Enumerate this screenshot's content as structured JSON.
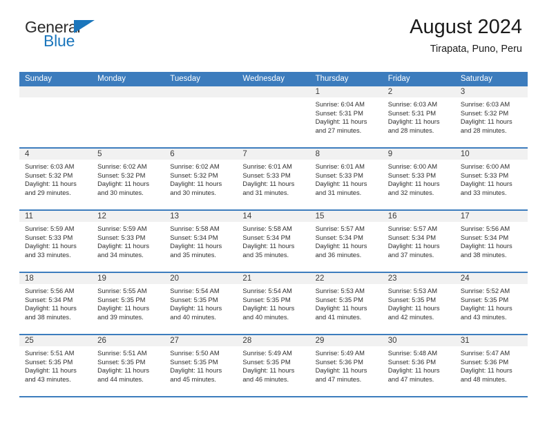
{
  "brand": {
    "name_part1": "General",
    "name_part2": "Blue",
    "triangle_icon": "blue-triangle-logo-mark",
    "color_dark": "#2b2b2b",
    "color_blue": "#1b76bc"
  },
  "header": {
    "title": "August 2024",
    "subtitle": "Tirapata, Puno, Peru"
  },
  "theme": {
    "header_row_bg": "#3c7cbd",
    "day_band_bg": "#f1f1f1",
    "cell_bg": "#ffffff",
    "text": "#2e2e2e"
  },
  "weekdays": [
    "Sunday",
    "Monday",
    "Tuesday",
    "Wednesday",
    "Thursday",
    "Friday",
    "Saturday"
  ],
  "weeks": [
    [
      {
        "day": "",
        "empty": true,
        "lines": []
      },
      {
        "day": "",
        "empty": true,
        "lines": []
      },
      {
        "day": "",
        "empty": true,
        "lines": []
      },
      {
        "day": "",
        "empty": true,
        "lines": []
      },
      {
        "day": "1",
        "empty": false,
        "lines": [
          "Sunrise: 6:04 AM",
          "Sunset: 5:31 PM",
          "Daylight: 11 hours",
          "and 27 minutes."
        ]
      },
      {
        "day": "2",
        "empty": false,
        "lines": [
          "Sunrise: 6:03 AM",
          "Sunset: 5:31 PM",
          "Daylight: 11 hours",
          "and 28 minutes."
        ]
      },
      {
        "day": "3",
        "empty": false,
        "lines": [
          "Sunrise: 6:03 AM",
          "Sunset: 5:32 PM",
          "Daylight: 11 hours",
          "and 28 minutes."
        ]
      }
    ],
    [
      {
        "day": "4",
        "empty": false,
        "lines": [
          "Sunrise: 6:03 AM",
          "Sunset: 5:32 PM",
          "Daylight: 11 hours",
          "and 29 minutes."
        ]
      },
      {
        "day": "5",
        "empty": false,
        "lines": [
          "Sunrise: 6:02 AM",
          "Sunset: 5:32 PM",
          "Daylight: 11 hours",
          "and 30 minutes."
        ]
      },
      {
        "day": "6",
        "empty": false,
        "lines": [
          "Sunrise: 6:02 AM",
          "Sunset: 5:32 PM",
          "Daylight: 11 hours",
          "and 30 minutes."
        ]
      },
      {
        "day": "7",
        "empty": false,
        "lines": [
          "Sunrise: 6:01 AM",
          "Sunset: 5:33 PM",
          "Daylight: 11 hours",
          "and 31 minutes."
        ]
      },
      {
        "day": "8",
        "empty": false,
        "lines": [
          "Sunrise: 6:01 AM",
          "Sunset: 5:33 PM",
          "Daylight: 11 hours",
          "and 31 minutes."
        ]
      },
      {
        "day": "9",
        "empty": false,
        "lines": [
          "Sunrise: 6:00 AM",
          "Sunset: 5:33 PM",
          "Daylight: 11 hours",
          "and 32 minutes."
        ]
      },
      {
        "day": "10",
        "empty": false,
        "lines": [
          "Sunrise: 6:00 AM",
          "Sunset: 5:33 PM",
          "Daylight: 11 hours",
          "and 33 minutes."
        ]
      }
    ],
    [
      {
        "day": "11",
        "empty": false,
        "lines": [
          "Sunrise: 5:59 AM",
          "Sunset: 5:33 PM",
          "Daylight: 11 hours",
          "and 33 minutes."
        ]
      },
      {
        "day": "12",
        "empty": false,
        "lines": [
          "Sunrise: 5:59 AM",
          "Sunset: 5:33 PM",
          "Daylight: 11 hours",
          "and 34 minutes."
        ]
      },
      {
        "day": "13",
        "empty": false,
        "lines": [
          "Sunrise: 5:58 AM",
          "Sunset: 5:34 PM",
          "Daylight: 11 hours",
          "and 35 minutes."
        ]
      },
      {
        "day": "14",
        "empty": false,
        "lines": [
          "Sunrise: 5:58 AM",
          "Sunset: 5:34 PM",
          "Daylight: 11 hours",
          "and 35 minutes."
        ]
      },
      {
        "day": "15",
        "empty": false,
        "lines": [
          "Sunrise: 5:57 AM",
          "Sunset: 5:34 PM",
          "Daylight: 11 hours",
          "and 36 minutes."
        ]
      },
      {
        "day": "16",
        "empty": false,
        "lines": [
          "Sunrise: 5:57 AM",
          "Sunset: 5:34 PM",
          "Daylight: 11 hours",
          "and 37 minutes."
        ]
      },
      {
        "day": "17",
        "empty": false,
        "lines": [
          "Sunrise: 5:56 AM",
          "Sunset: 5:34 PM",
          "Daylight: 11 hours",
          "and 38 minutes."
        ]
      }
    ],
    [
      {
        "day": "18",
        "empty": false,
        "lines": [
          "Sunrise: 5:56 AM",
          "Sunset: 5:34 PM",
          "Daylight: 11 hours",
          "and 38 minutes."
        ]
      },
      {
        "day": "19",
        "empty": false,
        "lines": [
          "Sunrise: 5:55 AM",
          "Sunset: 5:35 PM",
          "Daylight: 11 hours",
          "and 39 minutes."
        ]
      },
      {
        "day": "20",
        "empty": false,
        "lines": [
          "Sunrise: 5:54 AM",
          "Sunset: 5:35 PM",
          "Daylight: 11 hours",
          "and 40 minutes."
        ]
      },
      {
        "day": "21",
        "empty": false,
        "lines": [
          "Sunrise: 5:54 AM",
          "Sunset: 5:35 PM",
          "Daylight: 11 hours",
          "and 40 minutes."
        ]
      },
      {
        "day": "22",
        "empty": false,
        "lines": [
          "Sunrise: 5:53 AM",
          "Sunset: 5:35 PM",
          "Daylight: 11 hours",
          "and 41 minutes."
        ]
      },
      {
        "day": "23",
        "empty": false,
        "lines": [
          "Sunrise: 5:53 AM",
          "Sunset: 5:35 PM",
          "Daylight: 11 hours",
          "and 42 minutes."
        ]
      },
      {
        "day": "24",
        "empty": false,
        "lines": [
          "Sunrise: 5:52 AM",
          "Sunset: 5:35 PM",
          "Daylight: 11 hours",
          "and 43 minutes."
        ]
      }
    ],
    [
      {
        "day": "25",
        "empty": false,
        "lines": [
          "Sunrise: 5:51 AM",
          "Sunset: 5:35 PM",
          "Daylight: 11 hours",
          "and 43 minutes."
        ]
      },
      {
        "day": "26",
        "empty": false,
        "lines": [
          "Sunrise: 5:51 AM",
          "Sunset: 5:35 PM",
          "Daylight: 11 hours",
          "and 44 minutes."
        ]
      },
      {
        "day": "27",
        "empty": false,
        "lines": [
          "Sunrise: 5:50 AM",
          "Sunset: 5:35 PM",
          "Daylight: 11 hours",
          "and 45 minutes."
        ]
      },
      {
        "day": "28",
        "empty": false,
        "lines": [
          "Sunrise: 5:49 AM",
          "Sunset: 5:35 PM",
          "Daylight: 11 hours",
          "and 46 minutes."
        ]
      },
      {
        "day": "29",
        "empty": false,
        "lines": [
          "Sunrise: 5:49 AM",
          "Sunset: 5:36 PM",
          "Daylight: 11 hours",
          "and 47 minutes."
        ]
      },
      {
        "day": "30",
        "empty": false,
        "lines": [
          "Sunrise: 5:48 AM",
          "Sunset: 5:36 PM",
          "Daylight: 11 hours",
          "and 47 minutes."
        ]
      },
      {
        "day": "31",
        "empty": false,
        "lines": [
          "Sunrise: 5:47 AM",
          "Sunset: 5:36 PM",
          "Daylight: 11 hours",
          "and 48 minutes."
        ]
      }
    ]
  ]
}
